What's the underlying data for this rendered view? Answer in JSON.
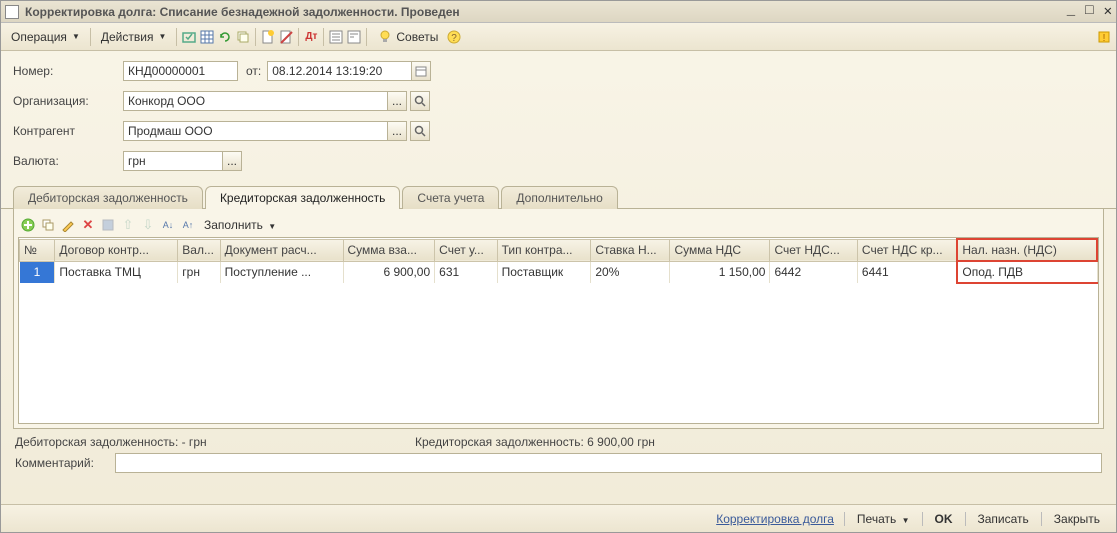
{
  "window": {
    "title": "Корректировка долга: Списание безнадежной задолженности. Проведен"
  },
  "menu": {
    "operation": "Операция",
    "actions": "Действия",
    "tips": "Советы"
  },
  "form": {
    "number_label": "Номер:",
    "number_value": "КНД00000001",
    "from_label": "от:",
    "date_value": "08.12.2014 13:19:20",
    "org_label": "Организация:",
    "org_value": "Конкорд ООО",
    "contractor_label": "Контрагент",
    "contractor_value": "Продмаш ООО",
    "currency_label": "Валюта:",
    "currency_value": "грн"
  },
  "tabs": {
    "t1": "Дебиторская задолженность",
    "t2": "Кредиторская задолженность",
    "t3": "Счета учета",
    "t4": "Дополнительно"
  },
  "grid_toolbar": {
    "fill": "Заполнить"
  },
  "columns": {
    "c0": "№",
    "c1": "Договор контр...",
    "c2": "Вал...",
    "c3": "Документ расч...",
    "c4": "Сумма вза...",
    "c5": "Счет у...",
    "c6": "Тип контра...",
    "c7": "Ставка Н...",
    "c8": "Сумма НДС",
    "c9": "Счет  НДС...",
    "c10": "Счет  НДС кр...",
    "c11": "Нал. назн. (НДС)"
  },
  "row": {
    "n": "1",
    "contract": "Поставка ТМЦ",
    "currency": "грн",
    "doc": "Поступление ...",
    "sum": "6 900,00",
    "acct": "631",
    "type": "Поставщик",
    "rate": "20%",
    "vat": "1 150,00",
    "vatacct": "6442",
    "vatcr": "6441",
    "nalog": "Опод. ПДВ"
  },
  "totals": {
    "debit": "Дебиторская задолженность: - грн",
    "credit": "Кредиторская задолженность: 6 900,00 грн"
  },
  "comment_label": "Комментарий:",
  "comment_value": "",
  "footer": {
    "link": "Корректировка долга",
    "print": "Печать",
    "ok": "OK",
    "save": "Записать",
    "close": "Закрыть"
  }
}
